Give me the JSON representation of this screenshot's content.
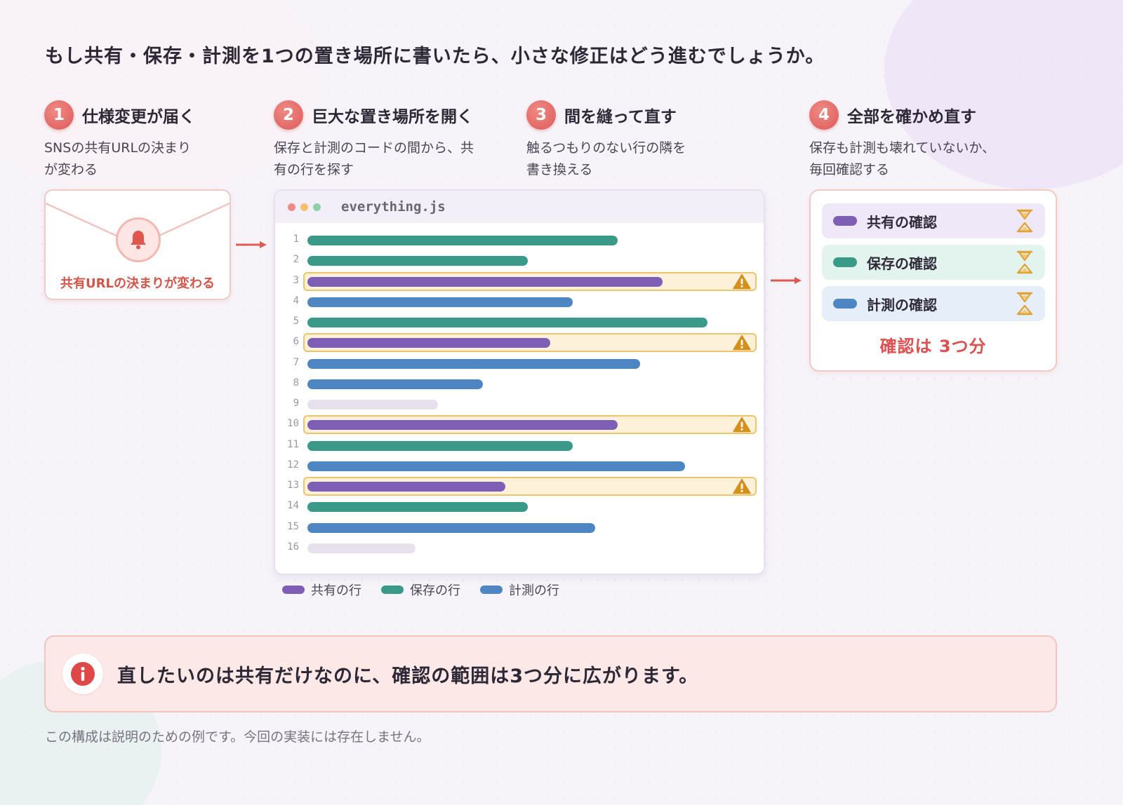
{
  "headline": "もし共有・保存・計測を1つの置き場所に書いたら、小さな修正はどう進むでしょうか。",
  "colors": {
    "accent": "#dd5a5a",
    "share": "#7f5fb5",
    "save": "#3a9a88",
    "measure": "#4e86c4",
    "empty": "#e6e1ec",
    "highlight": "#fdf1d9",
    "warning": "#d4901c"
  },
  "steps": [
    {
      "num": "1",
      "title": "仕様変更が届く",
      "desc_line1": "SNSの共有URLの決まり",
      "desc_line2": "が変わる"
    },
    {
      "num": "2",
      "title": "巨大な置き場所を開く",
      "desc_line1": "保存と計測のコードの間から、共",
      "desc_line2": "有の行を探す"
    },
    {
      "num": "3",
      "title": "間を縫って直す",
      "desc_line1": "触るつもりのない行の隣を",
      "desc_line2": "書き換える"
    },
    {
      "num": "4",
      "title": "全部を確かめ直す",
      "desc_line1": "保存も計測も壊れていないか、",
      "desc_line2": "毎回確認する"
    }
  ],
  "notice_card": {
    "icon": "bell-icon",
    "label": "共有URLの決まりが変わる"
  },
  "editor": {
    "filename": "everything.js",
    "lines": [
      {
        "n": "1",
        "kind": "save",
        "fill": 0.69,
        "warn": false
      },
      {
        "n": "2",
        "kind": "save",
        "fill": 0.49,
        "warn": false
      },
      {
        "n": "3",
        "kind": "share",
        "fill": 0.79,
        "warn": true
      },
      {
        "n": "4",
        "kind": "measure",
        "fill": 0.59,
        "warn": false
      },
      {
        "n": "5",
        "kind": "save",
        "fill": 0.89,
        "warn": false
      },
      {
        "n": "6",
        "kind": "share",
        "fill": 0.54,
        "warn": true
      },
      {
        "n": "7",
        "kind": "measure",
        "fill": 0.74,
        "warn": false
      },
      {
        "n": "8",
        "kind": "measure",
        "fill": 0.39,
        "warn": false
      },
      {
        "n": "9",
        "kind": "empty",
        "fill": 0.29,
        "warn": false
      },
      {
        "n": "10",
        "kind": "share",
        "fill": 0.69,
        "warn": true
      },
      {
        "n": "11",
        "kind": "save",
        "fill": 0.59,
        "warn": false
      },
      {
        "n": "12",
        "kind": "measure",
        "fill": 0.84,
        "warn": false
      },
      {
        "n": "13",
        "kind": "share",
        "fill": 0.44,
        "warn": true
      },
      {
        "n": "14",
        "kind": "save",
        "fill": 0.49,
        "warn": false
      },
      {
        "n": "15",
        "kind": "measure",
        "fill": 0.64,
        "warn": false
      },
      {
        "n": "16",
        "kind": "empty",
        "fill": 0.24,
        "warn": false
      }
    ]
  },
  "legend": [
    {
      "kind": "share",
      "label": "共有の行"
    },
    {
      "kind": "save",
      "label": "保存の行"
    },
    {
      "kind": "measure",
      "label": "計測の行"
    }
  ],
  "checks": {
    "items": [
      {
        "kind": "share",
        "label": "共有の確認",
        "bg": "#efe8f8",
        "icon": "hourglass-icon"
      },
      {
        "kind": "save",
        "label": "保存の確認",
        "bg": "#e3f4ef",
        "icon": "hourglass-icon"
      },
      {
        "kind": "measure",
        "label": "計測の確認",
        "bg": "#e6eff9",
        "icon": "hourglass-icon"
      }
    ],
    "total": "確認は 3つ分"
  },
  "callout": {
    "icon": "info-icon",
    "text": "直したいのは共有だけなのに、確認の範囲は3つ分に広がります。"
  },
  "footnote": "この構成は説明のための例です。今回の実装には存在しません。"
}
